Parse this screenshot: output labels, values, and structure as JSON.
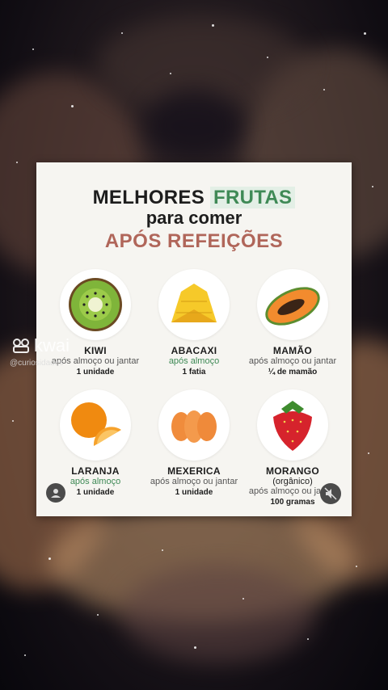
{
  "colors": {
    "accent_green": "#3f8a56",
    "accent_red": "#b0665a",
    "card_bg": "#f6f5f1"
  },
  "card": {
    "title_part1": "MELHORES",
    "title_highlight": "FRUTAS",
    "title_line2": "para comer",
    "title_line3": "APÓS REFEIÇÕES"
  },
  "fruits": [
    {
      "name": "KIWI",
      "when": "após almoço ou jantar",
      "qty": "1 unidade",
      "icon": "kiwi-icon"
    },
    {
      "name": "ABACAXI",
      "when": "após almoço",
      "qty": "1 fatia",
      "icon": "pineapple-icon"
    },
    {
      "name": "MAMÃO",
      "when": "após almoço ou jantar",
      "qty": "¼ de mamão",
      "icon": "papaya-icon"
    },
    {
      "name": "LARANJA",
      "when": "após almoço",
      "qty": "1 unidade",
      "icon": "orange-icon"
    },
    {
      "name": "MEXERICA",
      "when": "após almoço ou jantar",
      "qty": "1 unidade",
      "icon": "tangerine-icon"
    },
    {
      "name": "MORANGO",
      "subtitle": "(orgânico)",
      "when": "após almoço ou jantar",
      "qty": "100 gramas",
      "icon": "strawberry-icon"
    }
  ],
  "overlay": {
    "brand": "kwai",
    "username": "@curiosidades"
  },
  "icons": {
    "avatar": "user-icon",
    "mute": "speaker-muted-icon"
  }
}
